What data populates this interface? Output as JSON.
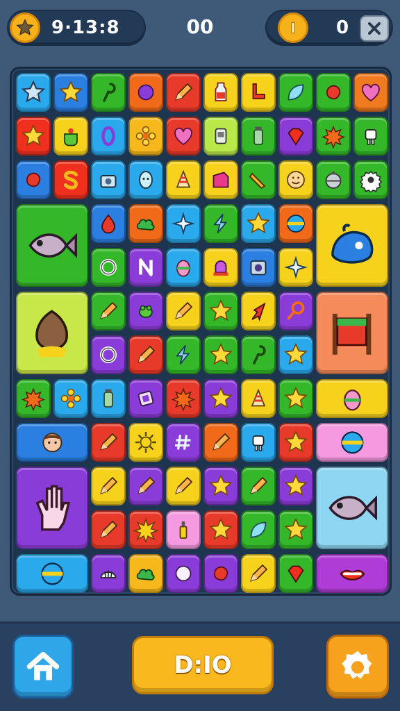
{
  "hud": {
    "timer": "9·13:8",
    "score": "00",
    "coins": "0"
  },
  "bottom": {
    "action_label": "D:IO"
  },
  "colors": {
    "background": "#3f5a78",
    "board": "#1e3550",
    "accent_yellow": "#f9b81d",
    "accent_blue": "#2fa6e8"
  },
  "tiles": [
    {
      "name": "tile-star-outline",
      "color": "#2aa9ec",
      "icon": "star-outline-icon"
    },
    {
      "name": "tile-star",
      "color": "#2a7fe0",
      "icon": "star-icon"
    },
    {
      "name": "tile-hook",
      "color": "#34b82a",
      "icon": "hook-icon"
    },
    {
      "name": "tile-circle",
      "color": "#f06a1a",
      "icon": "circle-icon"
    },
    {
      "name": "tile-pencil",
      "color": "#e83a2a",
      "icon": "pencil-icon"
    },
    {
      "name": "tile-bottle",
      "color": "#f6d21c",
      "icon": "bottle-icon"
    },
    {
      "name": "tile-chair",
      "color": "#f6d21c",
      "icon": "chair-icon"
    },
    {
      "name": "tile-leaf",
      "color": "#34b82a",
      "icon": "leaf-icon"
    },
    {
      "name": "tile-blob",
      "color": "#34b82a",
      "icon": "blob-icon"
    },
    {
      "name": "tile-heart",
      "color": "#f07a20",
      "icon": "heart-icon"
    },
    {
      "name": "tile-star-2",
      "color": "#f0301e",
      "icon": "star-icon"
    },
    {
      "name": "tile-pot",
      "color": "#f6d21c",
      "icon": "pot-icon"
    },
    {
      "name": "tile-zero",
      "color": "#2aa9ec",
      "icon": "zero-icon"
    },
    {
      "name": "tile-flower",
      "color": "#f6b81c",
      "icon": "flower-icon"
    },
    {
      "name": "tile-heart-2",
      "color": "#e83a2a",
      "icon": "heart-icon"
    },
    {
      "name": "tile-device",
      "color": "#b9e84a",
      "icon": "device-icon"
    },
    {
      "name": "tile-jar",
      "color": "#34b82a",
      "icon": "jar-icon"
    },
    {
      "name": "tile-gem",
      "color": "#8a3cd8",
      "icon": "gem-icon"
    },
    {
      "name": "tile-splat",
      "color": "#34b82a",
      "icon": "splat-icon"
    },
    {
      "name": "tile-robot",
      "color": "#34b82a",
      "icon": "robot-icon"
    },
    {
      "name": "tile-blob-red",
      "color": "#2a7fe0",
      "icon": "blob-icon"
    },
    {
      "name": "tile-letter-s",
      "color": "#f0301e",
      "icon": "letter-s-icon"
    },
    {
      "name": "tile-camera",
      "color": "#2aa9ec",
      "icon": "camera-icon"
    },
    {
      "name": "tile-face",
      "color": "#2aa9ec",
      "icon": "face-icon"
    },
    {
      "name": "tile-cone",
      "color": "#f6d21c",
      "icon": "cone-icon"
    },
    {
      "name": "tile-box",
      "color": "#f6d21c",
      "icon": "box-icon"
    },
    {
      "name": "tile-carrot",
      "color": "#34b82a",
      "icon": "carrot-icon"
    },
    {
      "name": "tile-smile",
      "color": "#f6d21c",
      "icon": "smile-icon"
    },
    {
      "name": "tile-ornament",
      "color": "#34b82a",
      "icon": "ornament-icon"
    },
    {
      "name": "tile-gear",
      "color": "#34b82a",
      "icon": "gear-icon"
    },
    {
      "name": "tile-fish-large",
      "color": "#34b82a",
      "icon": "fish-icon",
      "big": true
    },
    {
      "name": "tile-drop",
      "color": "#2a7fe0",
      "icon": "drop-icon"
    },
    {
      "name": "tile-bush",
      "color": "#f06a1a",
      "icon": "bush-icon"
    },
    {
      "name": "tile-sparkle",
      "color": "#2aa9ec",
      "icon": "sparkle-icon"
    },
    {
      "name": "tile-bolt",
      "color": "#34b82a",
      "icon": "bolt-icon"
    },
    {
      "name": "tile-star-3",
      "color": "#2aa9ec",
      "icon": "star-icon"
    },
    {
      "name": "tile-ball",
      "color": "#f06a1a",
      "icon": "ball-icon"
    },
    {
      "name": "tile-whale-large",
      "color": "#f6d21c",
      "icon": "whale-icon",
      "big": true
    },
    {
      "name": "tile-ring",
      "color": "#34b82a",
      "icon": "ring-icon"
    },
    {
      "name": "tile-letter-n",
      "color": "#8a3cd8",
      "icon": "letter-n-icon"
    },
    {
      "name": "tile-egg",
      "color": "#2aa9ec",
      "icon": "egg-icon"
    },
    {
      "name": "tile-bell",
      "color": "#f6d21c",
      "icon": "bell-icon"
    },
    {
      "name": "tile-radio",
      "color": "#2a7fe0",
      "icon": "radio-icon"
    },
    {
      "name": "tile-sparkle-2",
      "color": "#f6d21c",
      "icon": "sparkle-icon"
    },
    {
      "name": "tile-nut-large",
      "color": "#c8e84a",
      "icon": "nut-icon",
      "big": true
    },
    {
      "name": "tile-pencil-2",
      "color": "#34b82a",
      "icon": "pencil-icon"
    },
    {
      "name": "tile-frog",
      "color": "#8a3cd8",
      "icon": "frog-icon"
    },
    {
      "name": "tile-pencil-3",
      "color": "#f6d21c",
      "icon": "pencil-icon"
    },
    {
      "name": "tile-star-4",
      "color": "#34b82a",
      "icon": "star-icon"
    },
    {
      "name": "tile-arrow",
      "color": "#f6d21c",
      "icon": "arrow-icon"
    },
    {
      "name": "tile-magnifier",
      "color": "#8a3cd8",
      "icon": "magnifier-icon"
    },
    {
      "name": "tile-flag-large",
      "color": "#f58a5a",
      "icon": "flag-icon",
      "big": true
    },
    {
      "name": "tile-ring-2",
      "color": "#8a3cd8",
      "icon": "ring-icon"
    },
    {
      "name": "tile-pencil-4",
      "color": "#e83a2a",
      "icon": "pencil-icon"
    },
    {
      "name": "tile-bolt-2",
      "color": "#34b82a",
      "icon": "bolt-icon"
    },
    {
      "name": "tile-star-5",
      "color": "#34b82a",
      "icon": "star-icon"
    },
    {
      "name": "tile-hook-2",
      "color": "#34b82a",
      "icon": "hook-icon"
    },
    {
      "name": "tile-star-6",
      "color": "#2aa9ec",
      "icon": "star-icon"
    },
    {
      "name": "tile-splat-2",
      "color": "#34b82a",
      "icon": "splat-icon"
    },
    {
      "name": "tile-flower-2",
      "color": "#2aa9ec",
      "icon": "flower-icon"
    },
    {
      "name": "tile-jar-2",
      "color": "#2aa9ec",
      "icon": "jar-icon"
    },
    {
      "name": "tile-frame",
      "color": "#8a3cd8",
      "icon": "frame-icon"
    },
    {
      "name": "tile-splat-3",
      "color": "#e83a2a",
      "icon": "splat-icon"
    },
    {
      "name": "tile-star-7",
      "color": "#8a3cd8",
      "icon": "star-icon"
    },
    {
      "name": "tile-cone-2",
      "color": "#f6d21c",
      "icon": "cone-icon"
    },
    {
      "name": "tile-star-8",
      "color": "#34b82a",
      "icon": "star-icon"
    },
    {
      "name": "tile-egg-large",
      "color": "#f6d21c",
      "icon": "egg-icon",
      "wide": true
    },
    {
      "name": "tile-boy-large",
      "color": "#2a7fe0",
      "icon": "boy-icon",
      "wide": true
    },
    {
      "name": "tile-pencil-5",
      "color": "#e83a2a",
      "icon": "pencil-icon"
    },
    {
      "name": "tile-sun",
      "color": "#f6d21c",
      "icon": "sun-icon"
    },
    {
      "name": "tile-hash",
      "color": "#8a3cd8",
      "icon": "hash-icon"
    },
    {
      "name": "tile-pencil-6",
      "color": "#f06a1a",
      "icon": "pencil-icon"
    },
    {
      "name": "tile-robot-2",
      "color": "#2aa9ec",
      "icon": "robot-icon"
    },
    {
      "name": "tile-star-9",
      "color": "#e83a2a",
      "icon": "star-icon"
    },
    {
      "name": "tile-ball-large",
      "color": "#f59ae0",
      "icon": "ball-icon",
      "wide": true
    },
    {
      "name": "tile-hand-large",
      "color": "#8a3cd8",
      "icon": "hand-icon",
      "big": true
    },
    {
      "name": "tile-pencil-7",
      "color": "#f6d21c",
      "icon": "pencil-icon"
    },
    {
      "name": "tile-pencil-8",
      "color": "#8a3cd8",
      "icon": "pencil-icon"
    },
    {
      "name": "tile-pencil-9",
      "color": "#f6d21c",
      "icon": "pencil-icon"
    },
    {
      "name": "tile-star-10",
      "color": "#8a3cd8",
      "icon": "star-icon"
    },
    {
      "name": "tile-pencil-10",
      "color": "#34b82a",
      "icon": "pencil-icon"
    },
    {
      "name": "tile-star-11",
      "color": "#8a3cd8",
      "icon": "star-icon"
    },
    {
      "name": "tile-fish-2-large",
      "color": "#8fd6f2",
      "icon": "fish-icon",
      "big": true
    },
    {
      "name": "tile-pencil-11",
      "color": "#e83a2a",
      "icon": "pencil-icon"
    },
    {
      "name": "tile-burst",
      "color": "#e83a2a",
      "icon": "burst-icon"
    },
    {
      "name": "tile-nail",
      "color": "#f59ae0",
      "icon": "nail-icon"
    },
    {
      "name": "tile-star-12",
      "color": "#e83a2a",
      "icon": "star-icon"
    },
    {
      "name": "tile-leaf-2",
      "color": "#34b82a",
      "icon": "leaf-icon"
    },
    {
      "name": "tile-star-13",
      "color": "#34b82a",
      "icon": "star-icon"
    },
    {
      "name": "tile-ball-2-large",
      "color": "#2aa9ec",
      "icon": "ball-icon",
      "wide": true
    },
    {
      "name": "tile-shell",
      "color": "#8a3cd8",
      "icon": "shell-icon"
    },
    {
      "name": "tile-bush-2",
      "color": "#f6b81c",
      "icon": "bush-icon"
    },
    {
      "name": "tile-bubble",
      "color": "#8a3cd8",
      "icon": "bubble-icon"
    },
    {
      "name": "tile-blob-2",
      "color": "#8a3cd8",
      "icon": "blob-icon"
    },
    {
      "name": "tile-pencil-12",
      "color": "#f6d21c",
      "icon": "pencil-icon"
    },
    {
      "name": "tile-gem-2",
      "color": "#34b82a",
      "icon": "gem-icon"
    },
    {
      "name": "tile-lips-large",
      "color": "#b03cd8",
      "icon": "lips-icon",
      "wide": true
    }
  ]
}
